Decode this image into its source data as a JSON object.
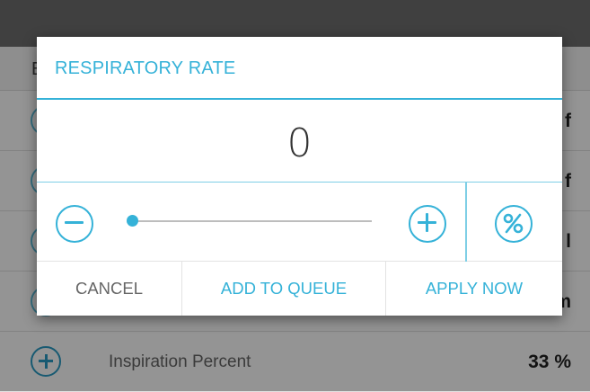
{
  "colors": {
    "accent": "#35b2d8",
    "accent_dark": "#2a9cc4",
    "text_muted": "#666666"
  },
  "background": {
    "header_letter": "E",
    "rows": [
      {
        "value": "f"
      },
      {
        "value": "f"
      },
      {
        "value": "l"
      },
      {
        "value": "m"
      }
    ],
    "visible_row": {
      "label": "Inspiration Percent",
      "value": "33 %"
    }
  },
  "dialog": {
    "title": "RESPIRATORY RATE",
    "value": "0",
    "slider": {
      "value": 0
    },
    "icons": {
      "decrease": "minus-circle-icon",
      "increase": "plus-circle-icon",
      "percent": "percent-circle-icon"
    },
    "actions": {
      "cancel": "CANCEL",
      "add_to_queue": "ADD TO QUEUE",
      "apply_now": "APPLY NOW"
    }
  }
}
